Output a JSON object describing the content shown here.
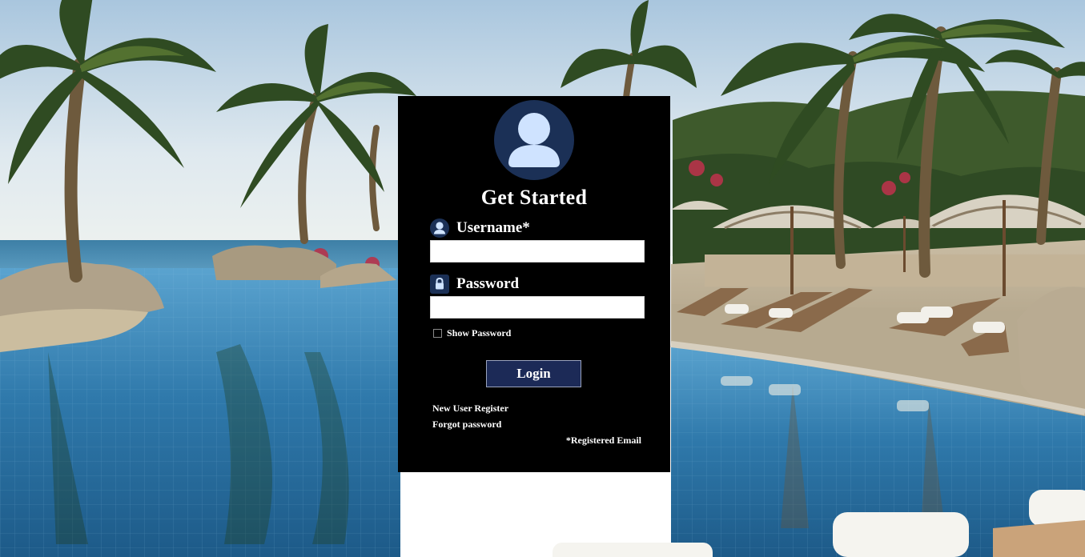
{
  "login": {
    "title": "Get Started",
    "username_label": "Username*",
    "username_value": "",
    "password_label": "Password",
    "password_value": "",
    "show_password_label": "Show Password",
    "show_password_checked": false,
    "login_button": "Login",
    "register_link": "New User Register",
    "forgot_link": "Forgot password",
    "registered_email_note": "*Registered Email"
  },
  "icons": {
    "avatar": "user-avatar-icon",
    "username": "user-icon",
    "password": "lock-icon",
    "checkbox": "checkbox-unchecked"
  },
  "colors": {
    "card_background": "#000000",
    "button_background": "#1c2a57",
    "avatar_circle": "#1b3056",
    "avatar_figure": "#cfe3ff"
  }
}
